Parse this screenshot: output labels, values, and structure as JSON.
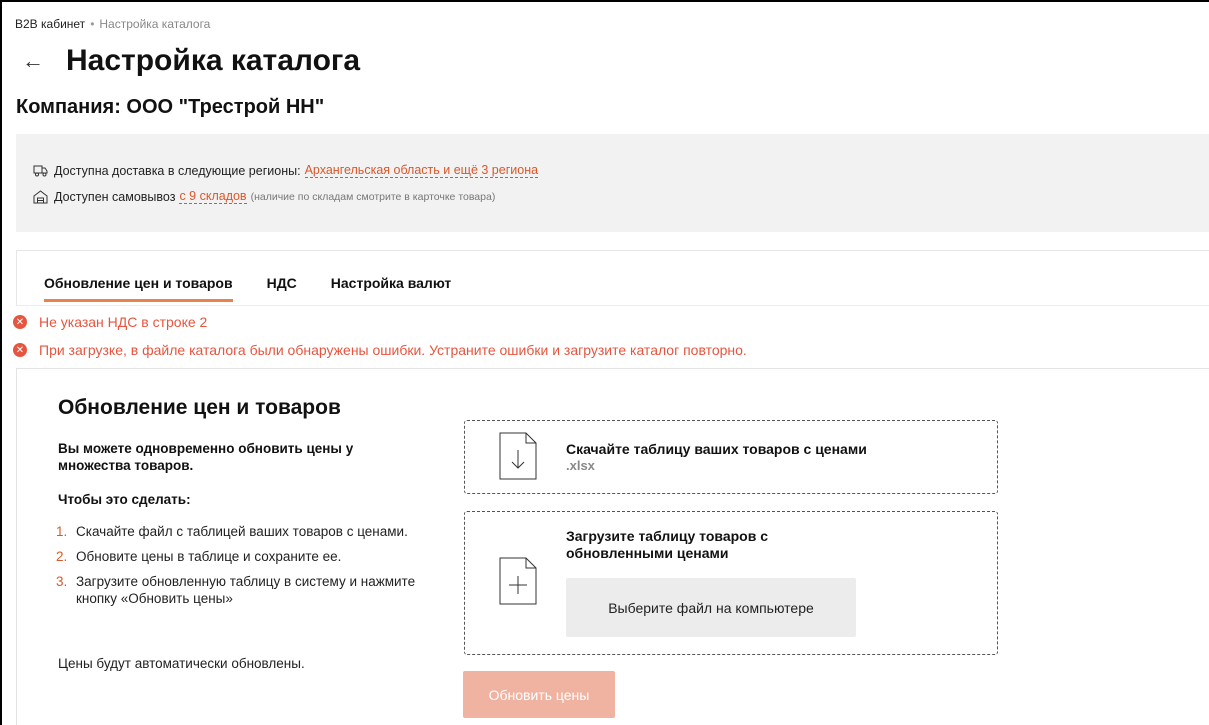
{
  "breadcrumb": {
    "root": "B2B кабинет",
    "separator": "•",
    "current": "Настройка каталога"
  },
  "header": {
    "back_icon": "arrow-left-icon",
    "title": "Настройка каталога"
  },
  "company": {
    "label": "Компания: ООО \"Трестрой НН\""
  },
  "info": {
    "delivery_text": "Доступна доставка в следующие регионы:",
    "delivery_link": "Архангельская область и ещё 3 региона",
    "pickup_text": "Доступен самовывоз",
    "pickup_link": "с 9 складов",
    "pickup_note": "(наличие по складам смотрите в карточке товара)"
  },
  "tabs": [
    {
      "label": "Обновление цен и товаров",
      "active": true
    },
    {
      "label": "НДС",
      "active": false
    },
    {
      "label": "Настройка валют",
      "active": false
    }
  ],
  "errors": [
    "Не указан НДС в строке 2",
    "При загрузке, в файле каталога были обнаружены ошибки. Устраните ошибки и загрузите каталог повторно."
  ],
  "section": {
    "title": "Обновление цен и товаров",
    "lead": "Вы можете одновременно обновить цены у множества товаров.",
    "howto": "Чтобы это сделать:",
    "steps": [
      {
        "num": "1.",
        "text": "Скачайте файл с таблицей ваших товаров с ценами."
      },
      {
        "num": "2.",
        "text": "Обновите цены в таблице и сохраните ее."
      },
      {
        "num": "3.",
        "text": "Загрузите обновленную таблицу в систему и нажмите кнопку «Обновить цены»"
      }
    ],
    "footer": "Цены будут автоматически обновлены."
  },
  "download": {
    "title": "Скачайте таблицу ваших товаров с ценами",
    "ext": ".xlsx"
  },
  "upload": {
    "title": "Загрузите таблицу товаров с обновленными ценами",
    "button": "Выберите файл на компьютере"
  },
  "update_button": "Обновить цены",
  "colors": {
    "accent": "#d9582b",
    "error": "#e6553f",
    "tab_underline": "#e8834d",
    "disabled_button": "#f0b3a1"
  }
}
